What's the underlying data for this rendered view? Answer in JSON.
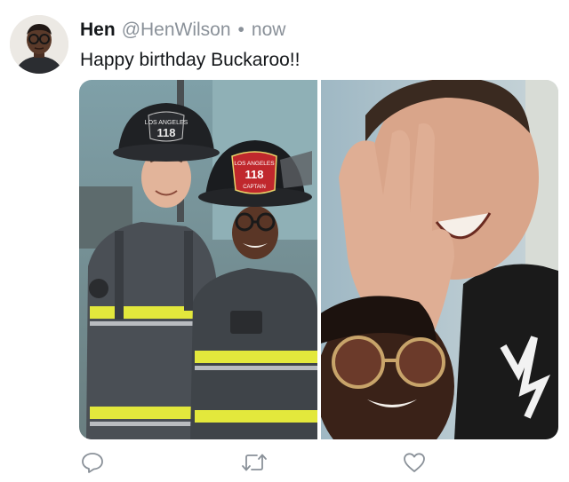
{
  "tweet": {
    "display_name": "Hen",
    "handle": "@HenWilson",
    "separator": "•",
    "timestamp": "now",
    "text": "Happy birthday Buckaroo!!"
  },
  "helmets": {
    "left": {
      "top_text": "LOS ANGELES",
      "number": "118"
    },
    "right": {
      "top_text": "LOS ANGELES",
      "number": "118",
      "rank": "CAPTAIN"
    }
  },
  "actions": {
    "reply_icon": "reply-icon",
    "retweet_icon": "retweet-icon",
    "like_icon": "heart-icon"
  },
  "colors": {
    "icon_gray": "#8a9199",
    "text_primary": "#14171a",
    "reflective_yellow": "#e5e83a",
    "helmet_red": "#c0282d"
  }
}
